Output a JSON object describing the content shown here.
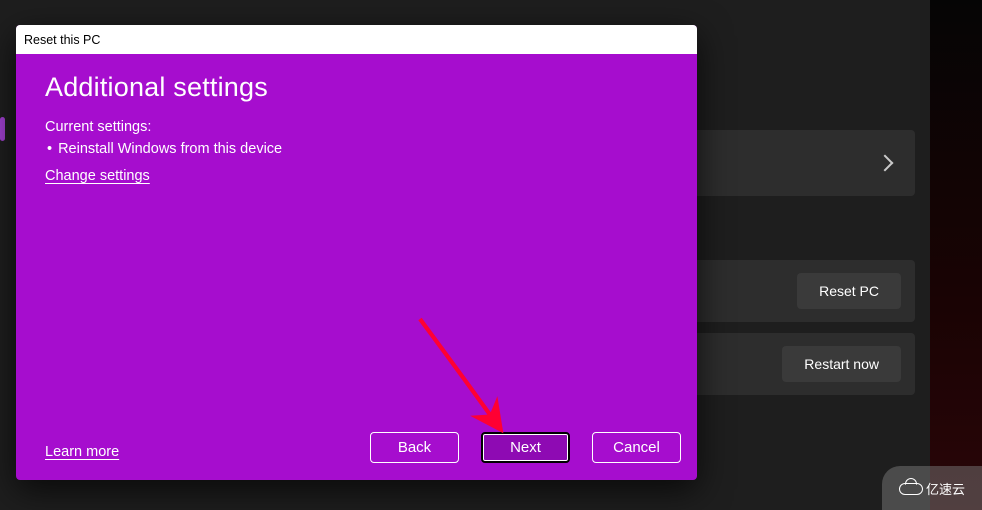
{
  "dialog": {
    "titlebar": "Reset this PC",
    "heading": "Additional settings",
    "current_settings_label": "Current settings:",
    "bullets": [
      "Reinstall Windows from this device"
    ],
    "change_settings": "Change settings",
    "learn_more": "Learn more",
    "buttons": {
      "back": "Back",
      "next": "Next",
      "cancel": "Cancel"
    }
  },
  "background": {
    "row_buttons": {
      "reset_pc": "Reset PC",
      "restart_now": "Restart now"
    }
  },
  "watermark": {
    "text": "亿速云"
  },
  "annotation": {
    "arrow_color": "#ff0033",
    "points_to": "next-button"
  }
}
